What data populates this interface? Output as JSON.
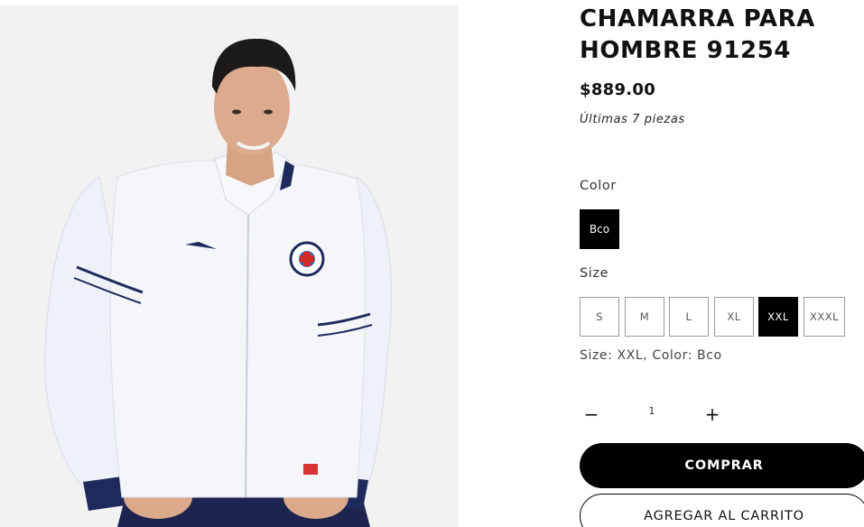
{
  "product": {
    "title": "CHAMARRA PARA HOMBRE 91254",
    "price": "$889.00",
    "stock_note": "Últimas 7 piezas",
    "image_subject": "man-wearing-white-jacket"
  },
  "options": {
    "color_label": "Color",
    "colors": [
      {
        "label": "Bco",
        "selected": true
      }
    ],
    "size_label": "Size",
    "sizes": [
      {
        "label": "S",
        "selected": false
      },
      {
        "label": "M",
        "selected": false
      },
      {
        "label": "L",
        "selected": false
      },
      {
        "label": "XL",
        "selected": false
      },
      {
        "label": "XXL",
        "selected": true
      },
      {
        "label": "XXXL",
        "selected": false
      }
    ],
    "selection_summary": "Size: XXL, Color: Bco"
  },
  "quantity": {
    "value": "1",
    "decrease_symbol": "−",
    "increase_symbol": "+"
  },
  "actions": {
    "buy_label": "COMPRAR",
    "add_to_cart_label": "AGREGAR AL CARRITO"
  },
  "colors": {
    "primary": "#000000",
    "background": "#ffffff",
    "image_bg": "#f2f2f2",
    "jacket": "#f4f6fa",
    "trim": "#1f2a5c"
  }
}
